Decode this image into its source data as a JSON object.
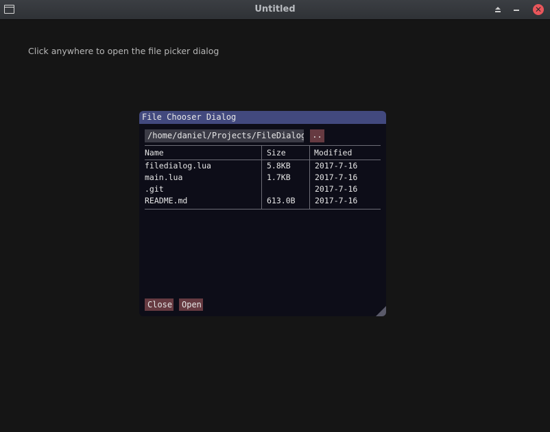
{
  "window": {
    "title": "Untitled",
    "close_glyph": "✕"
  },
  "main": {
    "hint": "Click anywhere to open the file picker dialog"
  },
  "dialog": {
    "title": "File Chooser Dialog",
    "path": "/home/daniel/Projects/FileDialog",
    "up_label": "..",
    "columns": {
      "name": "Name",
      "size": "Size",
      "modified": "Modified"
    },
    "files": [
      {
        "name": "filedialog.lua",
        "size": "5.8KB",
        "modified": "2017-7-16"
      },
      {
        "name": "main.lua",
        "size": "1.7KB",
        "modified": "2017-7-16"
      },
      {
        "name": ".git",
        "size": "",
        "modified": "2017-7-16"
      },
      {
        "name": "README.md",
        "size": "613.0B",
        "modified": "2017-7-16"
      }
    ],
    "close_label": "Close",
    "open_label": "Open"
  },
  "colors": {
    "background": "#151515",
    "titlebar": "#2f3236",
    "dialog_title": "#42497e",
    "button": "#663a41",
    "close_button": "#e9565b"
  }
}
